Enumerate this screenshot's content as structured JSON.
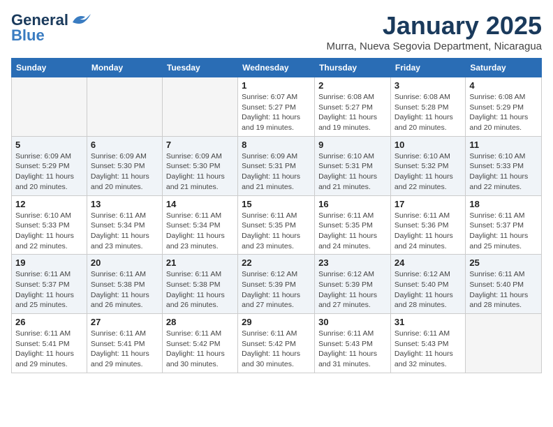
{
  "header": {
    "logo_general": "General",
    "logo_blue": "Blue",
    "month": "January 2025",
    "location": "Murra, Nueva Segovia Department, Nicaragua"
  },
  "weekdays": [
    "Sunday",
    "Monday",
    "Tuesday",
    "Wednesday",
    "Thursday",
    "Friday",
    "Saturday"
  ],
  "weeks": [
    [
      {
        "day": "",
        "sunrise": "",
        "sunset": "",
        "daylight": ""
      },
      {
        "day": "",
        "sunrise": "",
        "sunset": "",
        "daylight": ""
      },
      {
        "day": "",
        "sunrise": "",
        "sunset": "",
        "daylight": ""
      },
      {
        "day": "1",
        "sunrise": "Sunrise: 6:07 AM",
        "sunset": "Sunset: 5:27 PM",
        "daylight": "Daylight: 11 hours and 19 minutes."
      },
      {
        "day": "2",
        "sunrise": "Sunrise: 6:08 AM",
        "sunset": "Sunset: 5:27 PM",
        "daylight": "Daylight: 11 hours and 19 minutes."
      },
      {
        "day": "3",
        "sunrise": "Sunrise: 6:08 AM",
        "sunset": "Sunset: 5:28 PM",
        "daylight": "Daylight: 11 hours and 20 minutes."
      },
      {
        "day": "4",
        "sunrise": "Sunrise: 6:08 AM",
        "sunset": "Sunset: 5:29 PM",
        "daylight": "Daylight: 11 hours and 20 minutes."
      }
    ],
    [
      {
        "day": "5",
        "sunrise": "Sunrise: 6:09 AM",
        "sunset": "Sunset: 5:29 PM",
        "daylight": "Daylight: 11 hours and 20 minutes."
      },
      {
        "day": "6",
        "sunrise": "Sunrise: 6:09 AM",
        "sunset": "Sunset: 5:30 PM",
        "daylight": "Daylight: 11 hours and 20 minutes."
      },
      {
        "day": "7",
        "sunrise": "Sunrise: 6:09 AM",
        "sunset": "Sunset: 5:30 PM",
        "daylight": "Daylight: 11 hours and 21 minutes."
      },
      {
        "day": "8",
        "sunrise": "Sunrise: 6:09 AM",
        "sunset": "Sunset: 5:31 PM",
        "daylight": "Daylight: 11 hours and 21 minutes."
      },
      {
        "day": "9",
        "sunrise": "Sunrise: 6:10 AM",
        "sunset": "Sunset: 5:31 PM",
        "daylight": "Daylight: 11 hours and 21 minutes."
      },
      {
        "day": "10",
        "sunrise": "Sunrise: 6:10 AM",
        "sunset": "Sunset: 5:32 PM",
        "daylight": "Daylight: 11 hours and 22 minutes."
      },
      {
        "day": "11",
        "sunrise": "Sunrise: 6:10 AM",
        "sunset": "Sunset: 5:33 PM",
        "daylight": "Daylight: 11 hours and 22 minutes."
      }
    ],
    [
      {
        "day": "12",
        "sunrise": "Sunrise: 6:10 AM",
        "sunset": "Sunset: 5:33 PM",
        "daylight": "Daylight: 11 hours and 22 minutes."
      },
      {
        "day": "13",
        "sunrise": "Sunrise: 6:11 AM",
        "sunset": "Sunset: 5:34 PM",
        "daylight": "Daylight: 11 hours and 23 minutes."
      },
      {
        "day": "14",
        "sunrise": "Sunrise: 6:11 AM",
        "sunset": "Sunset: 5:34 PM",
        "daylight": "Daylight: 11 hours and 23 minutes."
      },
      {
        "day": "15",
        "sunrise": "Sunrise: 6:11 AM",
        "sunset": "Sunset: 5:35 PM",
        "daylight": "Daylight: 11 hours and 23 minutes."
      },
      {
        "day": "16",
        "sunrise": "Sunrise: 6:11 AM",
        "sunset": "Sunset: 5:35 PM",
        "daylight": "Daylight: 11 hours and 24 minutes."
      },
      {
        "day": "17",
        "sunrise": "Sunrise: 6:11 AM",
        "sunset": "Sunset: 5:36 PM",
        "daylight": "Daylight: 11 hours and 24 minutes."
      },
      {
        "day": "18",
        "sunrise": "Sunrise: 6:11 AM",
        "sunset": "Sunset: 5:37 PM",
        "daylight": "Daylight: 11 hours and 25 minutes."
      }
    ],
    [
      {
        "day": "19",
        "sunrise": "Sunrise: 6:11 AM",
        "sunset": "Sunset: 5:37 PM",
        "daylight": "Daylight: 11 hours and 25 minutes."
      },
      {
        "day": "20",
        "sunrise": "Sunrise: 6:11 AM",
        "sunset": "Sunset: 5:38 PM",
        "daylight": "Daylight: 11 hours and 26 minutes."
      },
      {
        "day": "21",
        "sunrise": "Sunrise: 6:11 AM",
        "sunset": "Sunset: 5:38 PM",
        "daylight": "Daylight: 11 hours and 26 minutes."
      },
      {
        "day": "22",
        "sunrise": "Sunrise: 6:12 AM",
        "sunset": "Sunset: 5:39 PM",
        "daylight": "Daylight: 11 hours and 27 minutes."
      },
      {
        "day": "23",
        "sunrise": "Sunrise: 6:12 AM",
        "sunset": "Sunset: 5:39 PM",
        "daylight": "Daylight: 11 hours and 27 minutes."
      },
      {
        "day": "24",
        "sunrise": "Sunrise: 6:12 AM",
        "sunset": "Sunset: 5:40 PM",
        "daylight": "Daylight: 11 hours and 28 minutes."
      },
      {
        "day": "25",
        "sunrise": "Sunrise: 6:11 AM",
        "sunset": "Sunset: 5:40 PM",
        "daylight": "Daylight: 11 hours and 28 minutes."
      }
    ],
    [
      {
        "day": "26",
        "sunrise": "Sunrise: 6:11 AM",
        "sunset": "Sunset: 5:41 PM",
        "daylight": "Daylight: 11 hours and 29 minutes."
      },
      {
        "day": "27",
        "sunrise": "Sunrise: 6:11 AM",
        "sunset": "Sunset: 5:41 PM",
        "daylight": "Daylight: 11 hours and 29 minutes."
      },
      {
        "day": "28",
        "sunrise": "Sunrise: 6:11 AM",
        "sunset": "Sunset: 5:42 PM",
        "daylight": "Daylight: 11 hours and 30 minutes."
      },
      {
        "day": "29",
        "sunrise": "Sunrise: 6:11 AM",
        "sunset": "Sunset: 5:42 PM",
        "daylight": "Daylight: 11 hours and 30 minutes."
      },
      {
        "day": "30",
        "sunrise": "Sunrise: 6:11 AM",
        "sunset": "Sunset: 5:43 PM",
        "daylight": "Daylight: 11 hours and 31 minutes."
      },
      {
        "day": "31",
        "sunrise": "Sunrise: 6:11 AM",
        "sunset": "Sunset: 5:43 PM",
        "daylight": "Daylight: 11 hours and 32 minutes."
      },
      {
        "day": "",
        "sunrise": "",
        "sunset": "",
        "daylight": ""
      }
    ]
  ]
}
